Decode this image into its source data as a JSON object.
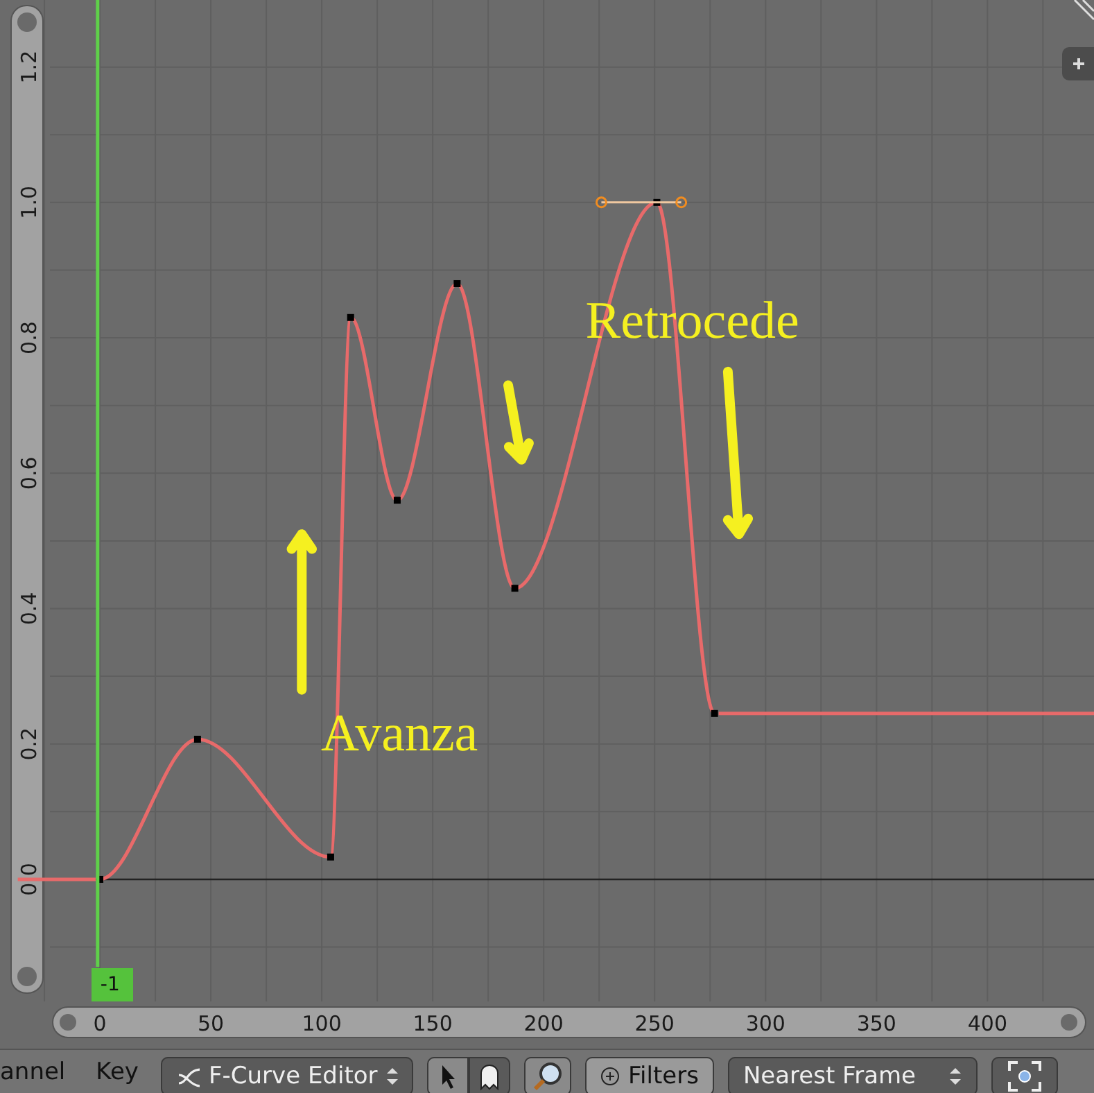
{
  "graph": {
    "playhead": {
      "label": "-1"
    },
    "chart_data": {
      "type": "line",
      "x": [
        0,
        44,
        104,
        113,
        134,
        161,
        187,
        251,
        277
      ],
      "series": [
        {
          "color": "#e86a6a",
          "marker": "square",
          "values": [
            0,
            0.207,
            0.033,
            0.83,
            0.56,
            0.88,
            0.43,
            1.0,
            0.245
          ]
        }
      ],
      "grid": true,
      "xlim": [
        -45,
        448
      ],
      "ylim": [
        -0.3156,
        1.299
      ],
      "xticks": [
        0,
        50,
        100,
        150,
        200,
        250,
        300,
        350,
        400
      ],
      "yticks": [
        {
          "value": 0,
          "label": "0.0"
        },
        {
          "value": 0.2,
          "label": "0.2"
        },
        {
          "value": 0.4,
          "label": "0.4"
        },
        {
          "value": 0.6,
          "label": "0.6"
        },
        {
          "value": 0.8,
          "label": "0.8"
        },
        {
          "value": 1.0,
          "label": "1.0"
        },
        {
          "value": 1.2,
          "label": "1.2"
        }
      ],
      "annotations": [
        "Avanza",
        "Retrocede"
      ]
    }
  },
  "header": {
    "menus": [
      "annel",
      "Key"
    ],
    "editor_mode": "F-Curve Editor",
    "filters": "Filters",
    "pivot": "Nearest Frame"
  }
}
